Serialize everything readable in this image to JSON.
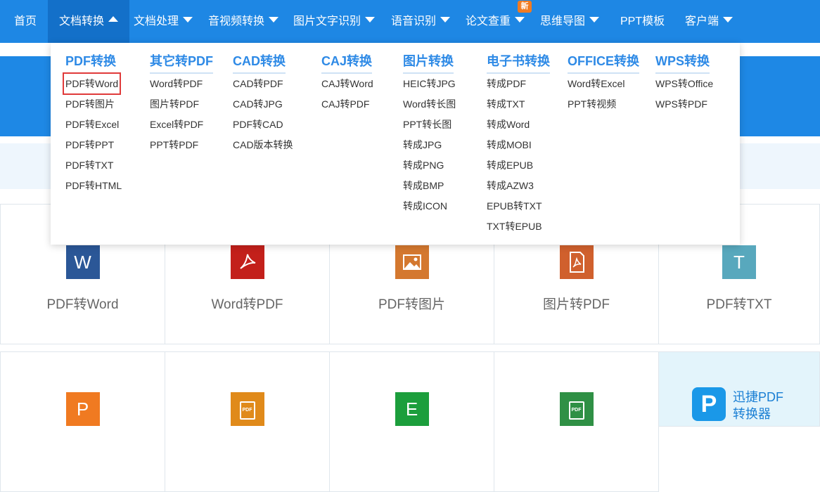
{
  "nav": {
    "items": [
      {
        "label": "首页",
        "caret": false
      },
      {
        "label": "文档转换",
        "caret": true,
        "active": true
      },
      {
        "label": "文档处理",
        "caret": true
      },
      {
        "label": "音视频转换",
        "caret": true
      },
      {
        "label": "图片文字识别",
        "caret": true
      },
      {
        "label": "语音识别",
        "caret": true
      },
      {
        "label": "论文查重",
        "caret": true
      },
      {
        "label": "思维导图",
        "caret": true
      },
      {
        "label": "PPT模板",
        "caret": false
      },
      {
        "label": "客户端",
        "caret": true
      }
    ],
    "new_badge": "新"
  },
  "dropdown": {
    "columns": [
      {
        "title": "PDF转换",
        "items": [
          "PDF转Word",
          "PDF转图片",
          "PDF转Excel",
          "PDF转PPT",
          "PDF转TXT",
          "PDF转HTML"
        ],
        "selected": 0
      },
      {
        "title": "其它转PDF",
        "items": [
          "Word转PDF",
          "图片转PDF",
          "Excel转PDF",
          "PPT转PDF"
        ]
      },
      {
        "title": "CAD转换",
        "items": [
          "CAD转PDF",
          "CAD转JPG",
          "PDF转CAD",
          "CAD版本转换"
        ]
      },
      {
        "title": "CAJ转换",
        "items": [
          "CAJ转Word",
          "CAJ转PDF"
        ]
      },
      {
        "title": "图片转换",
        "items": [
          "HEIC转JPG",
          "Word转长图",
          "PPT转长图",
          "转成JPG",
          "转成PNG",
          "转成BMP",
          "转成ICON"
        ]
      },
      {
        "title": "电子书转换",
        "items": [
          "转成PDF",
          "转成TXT",
          "转成Word",
          "转成MOBI",
          "转成EPUB",
          "转成AZW3",
          "EPUB转TXT",
          "TXT转EPUB"
        ]
      },
      {
        "title": "OFFICE转换",
        "items": [
          "Word转Excel",
          "PPT转视频"
        ]
      },
      {
        "title": "WPS转换",
        "items": [
          "WPS转Office",
          "WPS转PDF"
        ]
      }
    ]
  },
  "cards_row1": [
    {
      "label": "PDF转Word",
      "icon": "word-icon",
      "glyph": "W",
      "color": "#2b5797"
    },
    {
      "label": "Word转PDF",
      "icon": "pdf-icon",
      "glyph": "",
      "color": "#c3201b"
    },
    {
      "label": "PDF转图片",
      "icon": "image-icon",
      "glyph": "",
      "color": "#d4782f"
    },
    {
      "label": "图片转PDF",
      "icon": "pdf-icon",
      "glyph": "",
      "color": "#d0602d"
    },
    {
      "label": "PDF转TXT",
      "icon": "txt-icon",
      "glyph": "T",
      "color": "#58a8bd"
    }
  ],
  "cards_row2": [
    {
      "icon": "ppt-icon",
      "glyph": "P",
      "color": "#f07a21"
    },
    {
      "icon": "pdf-doc-icon",
      "glyph": "PDF",
      "color": "#e08a1a"
    },
    {
      "icon": "excel-icon",
      "glyph": "E",
      "color": "#1c9e3c"
    },
    {
      "icon": "pdf-doc-icon",
      "glyph": "PDF",
      "color": "#2f9045"
    }
  ],
  "promo": {
    "line1": "迅捷PDF",
    "line2": "转换器",
    "logo": "P"
  }
}
